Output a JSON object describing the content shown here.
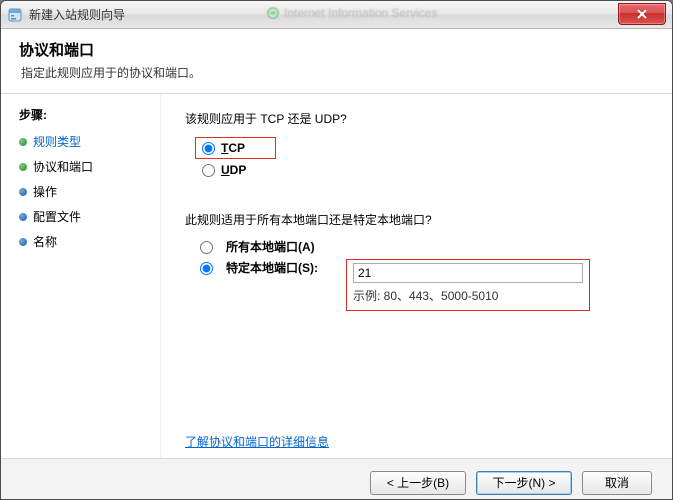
{
  "titlebar": {
    "title": "新建入站规则向导",
    "ghost_behind_1": "",
    "ghost_behind_2": "Internet Information Services"
  },
  "header": {
    "title": "协议和端口",
    "subtitle": "指定此规则应用于的协议和端口。"
  },
  "sidebar": {
    "steps_label": "步骤:",
    "items": [
      {
        "label": "规则类型",
        "state": "current"
      },
      {
        "label": "协议和端口",
        "state": "done"
      },
      {
        "label": "操作",
        "state": "todo"
      },
      {
        "label": "配置文件",
        "state": "todo"
      },
      {
        "label": "名称",
        "state": "todo"
      }
    ]
  },
  "content": {
    "protocol_question": "该规则应用于 TCP 还是 UDP?",
    "protocol": {
      "tcp_label": "TCP",
      "udp_label": "UDP",
      "selected": "tcp"
    },
    "port_question": "此规则适用于所有本地端口还是特定本地端口?",
    "port_options": {
      "all_label": "所有本地端口(A)",
      "specific_label": "特定本地端口(S):",
      "selected": "specific",
      "value": "21",
      "example_prefix": "示例: ",
      "example_value": "80、443、5000-5010"
    },
    "help_link": "了解协议和端口的详细信息"
  },
  "footer": {
    "back": "< 上一步(B)",
    "next": "下一步(N) >",
    "cancel": "取消"
  }
}
